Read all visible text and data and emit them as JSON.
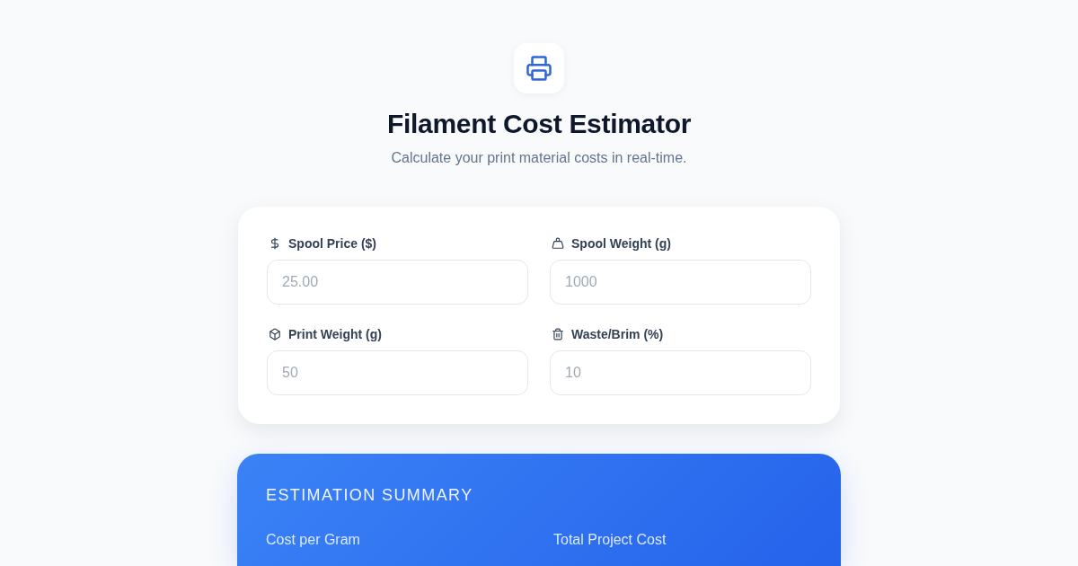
{
  "header": {
    "title": "Filament Cost Estimator",
    "subtitle": "Calculate your print material costs in real-time."
  },
  "fields": [
    {
      "label": "Spool Price ($)",
      "placeholder": "25.00"
    },
    {
      "label": "Spool Weight (g)",
      "placeholder": "1000"
    },
    {
      "label": "Print Weight (g)",
      "placeholder": "50"
    },
    {
      "label": "Waste/Brim (%)",
      "placeholder": "10"
    }
  ],
  "summary": {
    "title": "ESTIMATION SUMMARY",
    "metrics": [
      {
        "label": "Cost per Gram"
      },
      {
        "label": "Total Project Cost"
      }
    ]
  }
}
